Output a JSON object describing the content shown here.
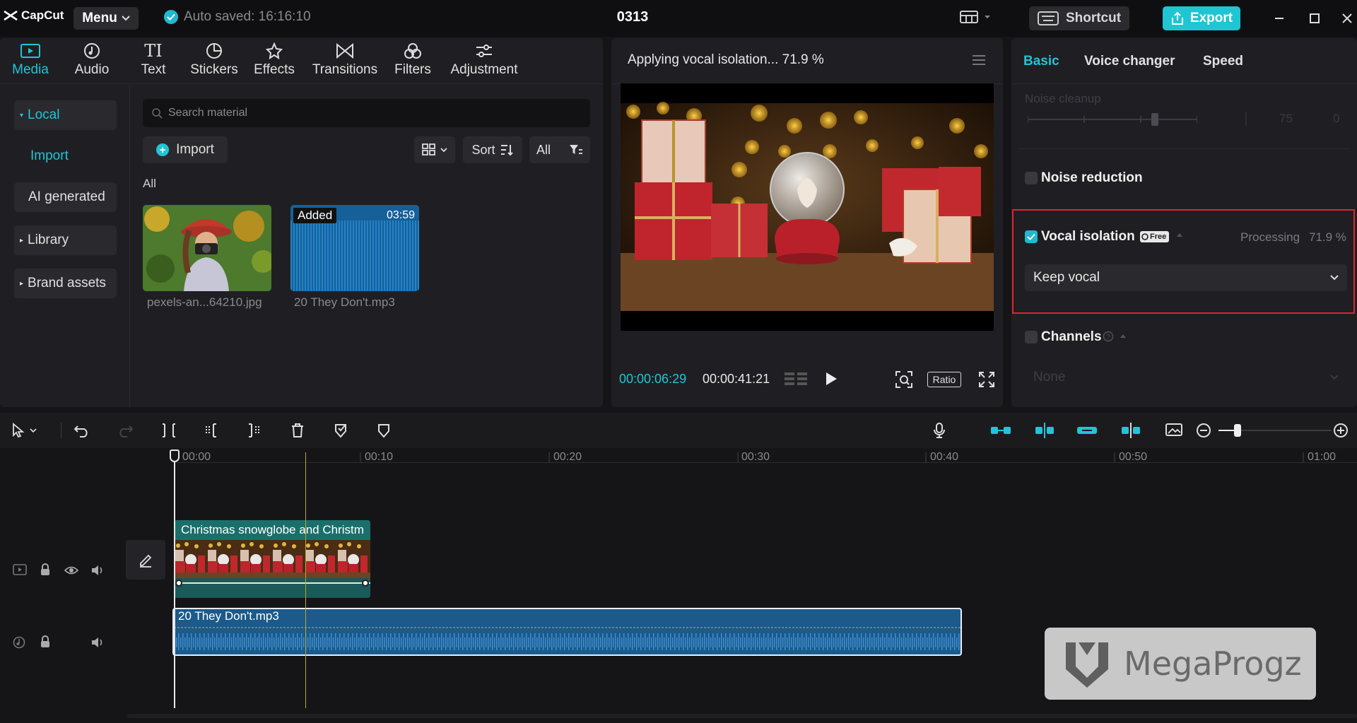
{
  "app": {
    "logo_text": "CapCut",
    "menu_label": "Menu",
    "autosave_text": "Auto saved: 16:16:10",
    "project_title": "0313",
    "shortcut_label": "Shortcut",
    "export_label": "Export"
  },
  "media_toolbar": {
    "tabs": [
      {
        "label": "Media",
        "icon": "media-icon",
        "active": true
      },
      {
        "label": "Audio",
        "icon": "audio-icon"
      },
      {
        "label": "Text",
        "icon": "text-icon"
      },
      {
        "label": "Stickers",
        "icon": "stickers-icon"
      },
      {
        "label": "Effects",
        "icon": "effects-icon"
      },
      {
        "label": "Transitions",
        "icon": "transitions-icon"
      },
      {
        "label": "Filters",
        "icon": "filters-icon"
      },
      {
        "label": "Adjustment",
        "icon": "adjustment-icon"
      }
    ]
  },
  "media_sidebar": {
    "items": [
      {
        "label": "Local"
      },
      {
        "label": "Import"
      },
      {
        "label": "AI generated"
      },
      {
        "label": "Library"
      },
      {
        "label": "Brand assets"
      }
    ]
  },
  "media_main": {
    "search_placeholder": "Search material",
    "import_label": "Import",
    "sort_label": "Sort",
    "filter_label": "All",
    "section_label": "All",
    "items": [
      {
        "name": "pexels-an...64210.jpg"
      },
      {
        "name": "20 They Don't.mp3",
        "badge": "Added",
        "duration": "03:59"
      }
    ]
  },
  "player": {
    "status": "Applying vocal isolation...  71.9 %",
    "current_time": "00:00:06:29",
    "total_time": "00:00:41:21",
    "ratio_label": "Ratio"
  },
  "properties": {
    "tabs": [
      {
        "label": "Basic",
        "active": true
      },
      {
        "label": "Voice changer"
      },
      {
        "label": "Speed"
      }
    ],
    "noise_cleanup_label": "Noise cleanup",
    "noise_cleanup_value": "75",
    "noise_cleanup_level": 0.75,
    "noise_cleanup_extra": "0",
    "noise_reduction_label": "Noise reduction",
    "vocal_isolation_label": "Vocal isolation",
    "vocal_isolation_badge": "Free",
    "processing_label": "Processing",
    "processing_value": "71.9 %",
    "vocal_option": "Keep vocal",
    "channels_label": "Channels",
    "channels_value": "None"
  },
  "timeline": {
    "ruler": [
      "00:00",
      "00:10",
      "00:20",
      "00:30",
      "00:40",
      "00:50",
      "01:00"
    ],
    "video_clip_label": "Christmas snowglobe and Christm",
    "audio_clip_label": "20 They Don't.mp3"
  },
  "watermark": {
    "text": "MegaProgz"
  },
  "colors": {
    "accent": "#22c4d6",
    "export": "#1fc5d3",
    "highlight": "#e0242a",
    "audio_clip": "#1b5a8a",
    "video_clip": "#1d5c5a"
  }
}
